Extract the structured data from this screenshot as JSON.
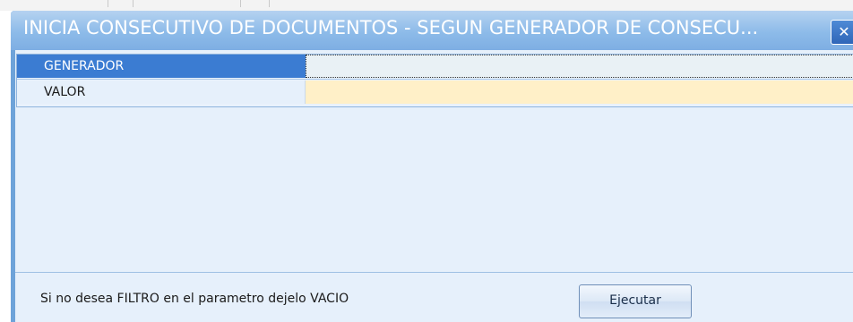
{
  "window": {
    "title": "INICIA CONSECUTIVO DE DOCUMENTOS - SEGUN GENERADOR DE CONSECU...",
    "close_glyph": "✕"
  },
  "params": [
    {
      "label": "GENERADOR",
      "value": ""
    },
    {
      "label": "VALOR",
      "value": ""
    }
  ],
  "footer": {
    "hint": "Si no desea FILTRO en el parametro dejelo VACIO",
    "execute_label": "Ejecutar"
  },
  "colors": {
    "selected_row": "#3b7cd2",
    "value_highlight": "#fff0c8",
    "panel_background": "#e6f0fb"
  },
  "icons": {
    "close": "close-icon"
  }
}
